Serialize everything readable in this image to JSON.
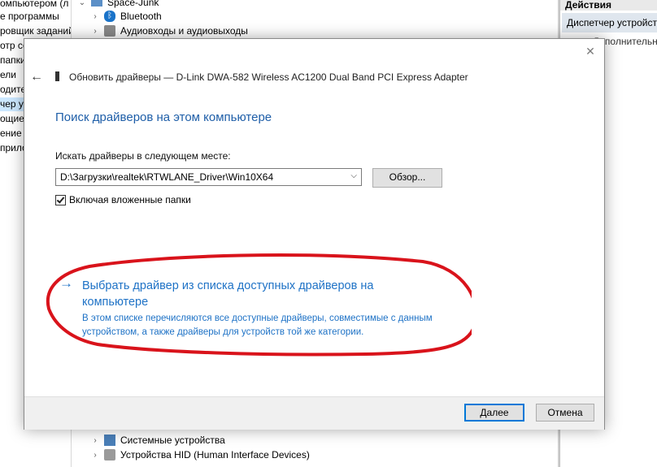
{
  "background": {
    "left_pane_items": [
      {
        "label": "омпьютером (л",
        "selected": false
      },
      {
        "label": "е программы",
        "selected": false
      },
      {
        "label": "ровщик заданий",
        "selected": false
      },
      {
        "label": "отр со",
        "selected": false
      },
      {
        "label": "папки",
        "selected": false
      },
      {
        "label": "ели",
        "selected": false
      },
      {
        "label": "одите",
        "selected": false
      },
      {
        "label": "чер ус",
        "selected": true
      },
      {
        "label": "ощие",
        "selected": false
      },
      {
        "label": "ение д",
        "selected": false
      },
      {
        "label": "прило",
        "selected": false
      }
    ],
    "tree_top": [
      {
        "label": "Space-Junk",
        "chevron": "v"
      },
      {
        "label": "Bluetooth",
        "chevron": ">"
      },
      {
        "label": "Аудиовходы и аудиовыходы",
        "chevron": ">"
      }
    ],
    "tree_bottom": [
      {
        "label": "Системные устройства",
        "chevron": ">"
      },
      {
        "label": "Устройства HID (Human Interface Devices)",
        "chevron": ">"
      }
    ],
    "actions_header": "Действия",
    "actions_item": "Диспетчер устройств",
    "actions_item2": "Дополнительные"
  },
  "dialog": {
    "title": "Обновить драйверы — D-Link DWA-582 Wireless AC1200 Dual Band PCI Express Adapter",
    "heading": "Поиск драйверов на этом компьютере",
    "search_label": "Искать драйверы в следующем месте:",
    "path_value": "D:\\Загрузки\\realtek\\RTWLANE_Driver\\Win10X64",
    "browse_label": "Обзор...",
    "include_subfolders_label": "Включая вложенные папки",
    "include_subfolders_checked": true,
    "pick_link_title": "Выбрать драйвер из списка доступных драйверов на компьютере",
    "pick_link_desc": "В этом списке перечисляются все доступные драйверы, совместимые с данным устройством, а также драйверы для устройств той же категории.",
    "next_label": "Далее",
    "cancel_label": "Отмена",
    "accent_color": "#1e72c6",
    "highlight_color": "#d9131b"
  }
}
